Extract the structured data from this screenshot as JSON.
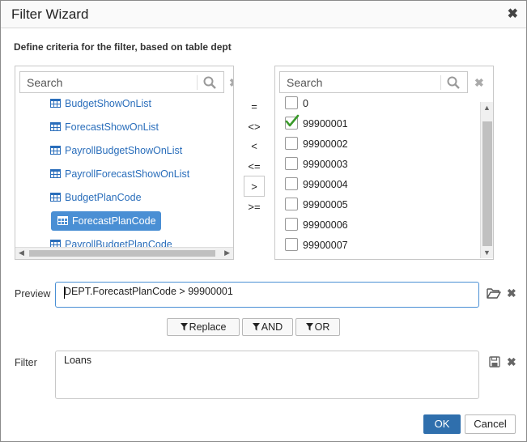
{
  "dialog": {
    "title": "Filter Wizard",
    "close_glyph": "✖",
    "description": "Define criteria for the filter, based on table dept"
  },
  "left_panel": {
    "search_placeholder": "Search",
    "clear_glyph": "✖",
    "items": [
      {
        "label": "BudgetShowOnList",
        "selected": false
      },
      {
        "label": "ForecastShowOnList",
        "selected": false
      },
      {
        "label": "PayrollBudgetShowOnList",
        "selected": false
      },
      {
        "label": "PayrollForecastShowOnList",
        "selected": false
      },
      {
        "label": "BudgetPlanCode",
        "selected": false
      },
      {
        "label": "ForecastPlanCode",
        "selected": true
      },
      {
        "label": "PayrollBudgetPlanCode",
        "selected": false
      }
    ]
  },
  "operators": [
    "=",
    "<>",
    "<",
    "<=",
    ">",
    ">="
  ],
  "active_operator": ">",
  "right_panel": {
    "search_placeholder": "Search",
    "clear_glyph": "✖",
    "values": [
      {
        "label": "0",
        "checked": false
      },
      {
        "label": "99900001",
        "checked": true
      },
      {
        "label": "99900002",
        "checked": false
      },
      {
        "label": "99900003",
        "checked": false
      },
      {
        "label": "99900004",
        "checked": false
      },
      {
        "label": "99900005",
        "checked": false
      },
      {
        "label": "99900006",
        "checked": false
      },
      {
        "label": "99900007",
        "checked": false
      }
    ]
  },
  "preview": {
    "label": "Preview",
    "value": "DEPT.ForecastPlanCode > 99900001"
  },
  "combine_buttons": {
    "replace": "Replace",
    "and": "AND",
    "or": "OR"
  },
  "filter": {
    "label": "Filter",
    "value": "Loans"
  },
  "footer": {
    "ok": "OK",
    "cancel": "Cancel"
  },
  "colors": {
    "accent": "#4a8fd4",
    "link": "#2a6ebb",
    "ok_button": "#2f6fad",
    "check": "#3a9a2a"
  },
  "icons": [
    "search-icon",
    "clear-icon",
    "table-icon",
    "checkmark-icon",
    "folder-open-icon",
    "save-icon",
    "funnel-icon",
    "close-icon"
  ]
}
